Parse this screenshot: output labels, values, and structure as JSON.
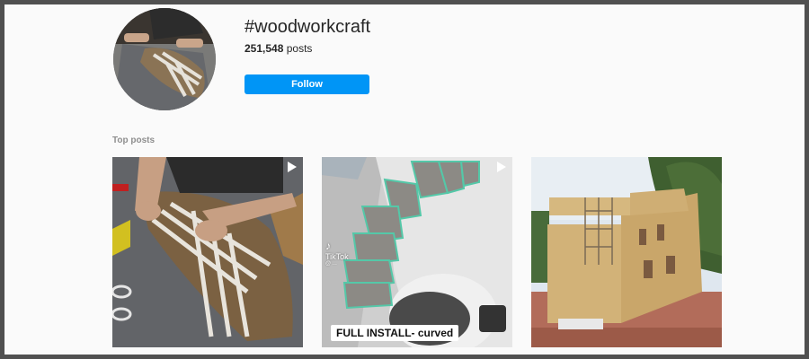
{
  "header": {
    "hashtag": "#woodworkcraft",
    "post_count": "251,548",
    "post_count_suffix": " posts",
    "follow_label": "Follow"
  },
  "section": {
    "title": "Top posts"
  },
  "posts": [
    {
      "type": "reel",
      "icon": "play-icon"
    },
    {
      "type": "reel",
      "icon": "play-icon",
      "watermark": "TikTok",
      "watermark_handle": "@ ...",
      "caption": "FULL INSTALL- curved"
    },
    {
      "type": "photo"
    }
  ],
  "colors": {
    "accent": "#0095f6",
    "text": "#262626",
    "muted": "#8e8e8e",
    "background": "#fafafa"
  }
}
